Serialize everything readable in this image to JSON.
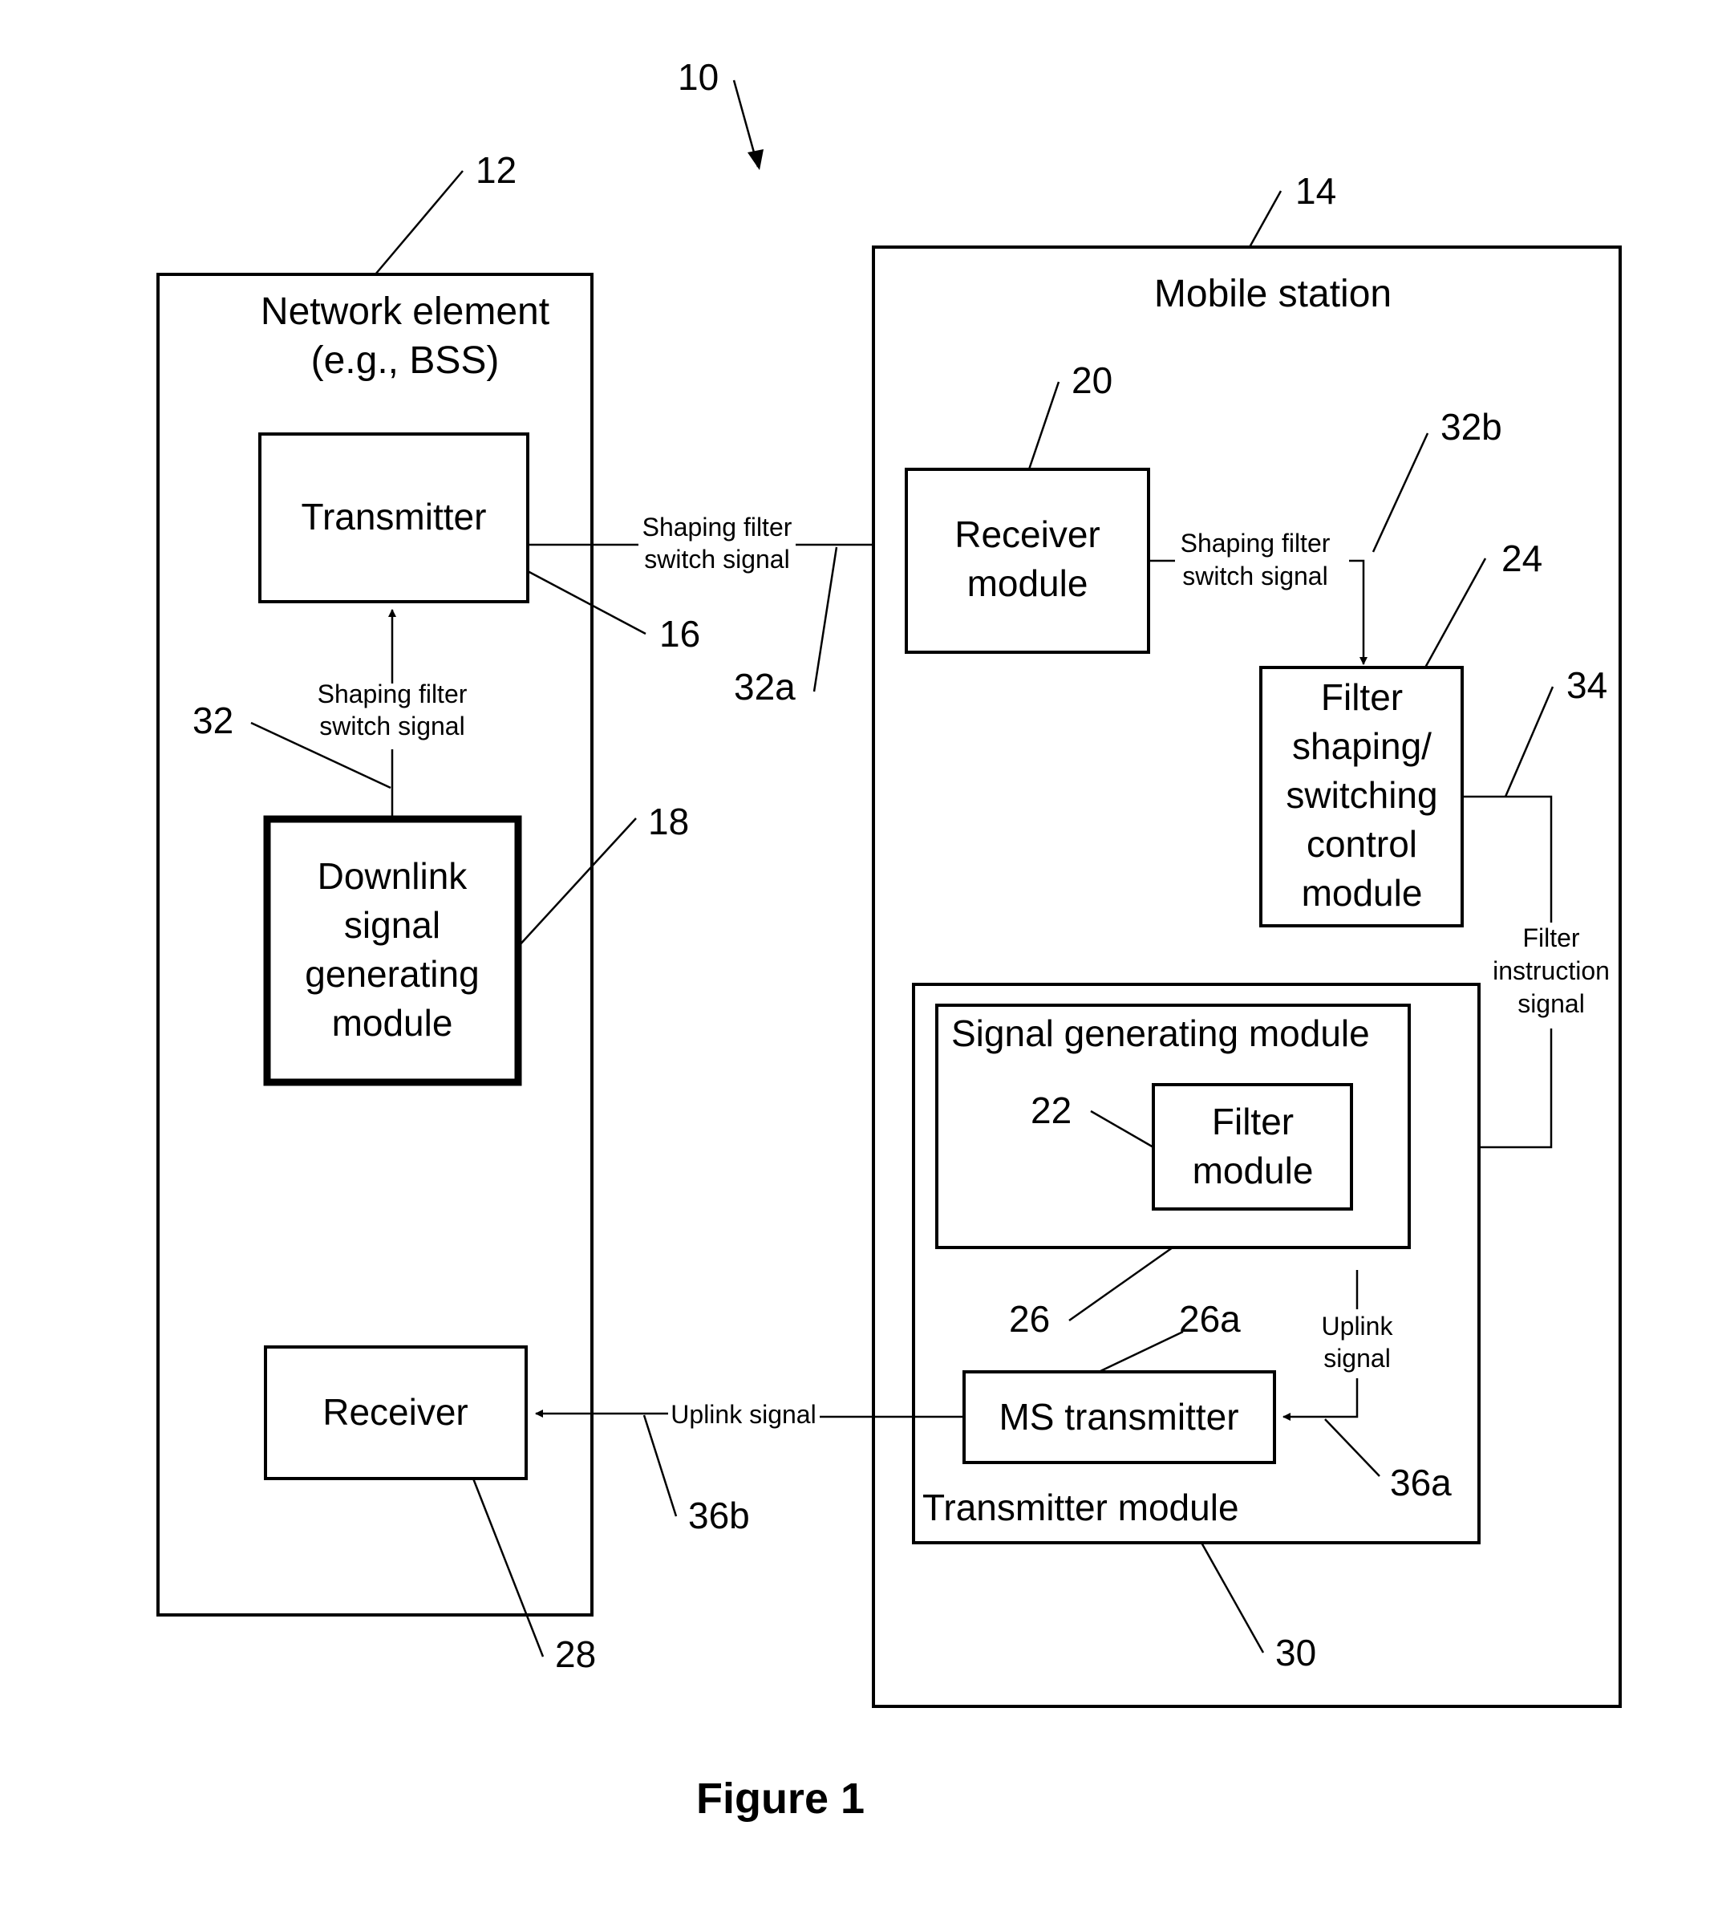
{
  "figure": {
    "caption": "Figure 1",
    "ref_system": "10"
  },
  "network_element": {
    "ref": "12",
    "title_line1": "Network element",
    "title_line2": "(e.g., BSS)",
    "transmitter": {
      "ref": "16",
      "label": "Transmitter"
    },
    "downlink_module": {
      "ref": "18",
      "lines": [
        "Downlink",
        "signal",
        "generating",
        "module"
      ]
    },
    "receiver": {
      "ref": "28",
      "label": "Receiver"
    },
    "internal_signal": {
      "ref": "32",
      "lines": [
        "Shaping filter",
        "switch signal"
      ]
    }
  },
  "mobile_station": {
    "ref": "14",
    "title": "Mobile station",
    "receiver_module": {
      "ref": "20",
      "lines": [
        "Receiver",
        "module"
      ]
    },
    "filter_control_module": {
      "ref": "24",
      "lines": [
        "Filter",
        "shaping/",
        "switching",
        "control",
        "module"
      ]
    },
    "transmitter_module": {
      "ref": "30",
      "label": "Transmitter module"
    },
    "signal_generating_module": {
      "ref": "26",
      "label": "Signal generating module"
    },
    "filter_module": {
      "ref": "22",
      "lines": [
        "Filter",
        "module"
      ]
    },
    "ms_transmitter": {
      "ref": "26a",
      "label": "MS transmitter"
    }
  },
  "signals": {
    "downlink": {
      "ref": "32a",
      "lines": [
        "Shaping filter",
        "switch signal"
      ]
    },
    "internal_ms": {
      "ref": "32b",
      "lines": [
        "Shaping filter",
        "switch signal"
      ]
    },
    "filter_instruction": {
      "ref": "34",
      "lines": [
        "Filter",
        "instruction",
        "signal"
      ]
    },
    "uplink_internal": {
      "ref": "36a",
      "lines": [
        "Uplink",
        "signal"
      ]
    },
    "uplink": {
      "ref": "36b",
      "label": "Uplink signal"
    }
  }
}
